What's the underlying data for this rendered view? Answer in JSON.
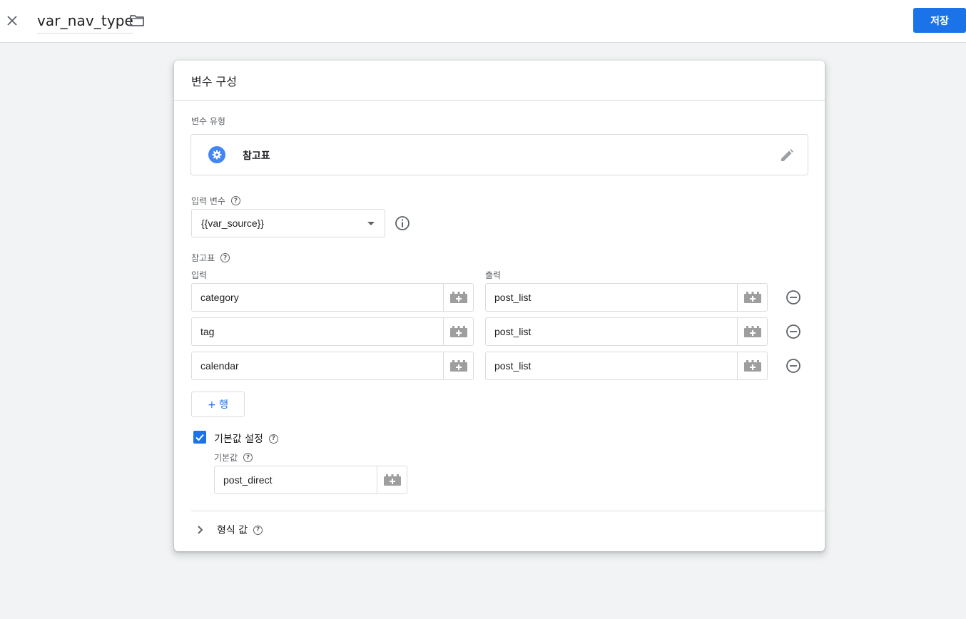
{
  "header": {
    "title": "var_nav_type",
    "save_label": "저장"
  },
  "card": {
    "title": "변수 구성",
    "variable_type": {
      "label": "변수 유형",
      "name": "참고표",
      "icon": "gear-icon"
    },
    "input_variable": {
      "label": "입력 변수",
      "selected": "{{var_source}}"
    },
    "lookup_table": {
      "label": "참고표",
      "input_header": "입력",
      "output_header": "출력",
      "rows": [
        {
          "input": "category",
          "output": "post_list"
        },
        {
          "input": "tag",
          "output": "post_list"
        },
        {
          "input": "calendar",
          "output": "post_list"
        }
      ],
      "add_row_label": "+ 행"
    },
    "default_value": {
      "checkbox_label": "기본값 설정",
      "checked": true,
      "field_label": "기본값",
      "value": "post_direct"
    },
    "format_value": {
      "label": "형식 값"
    }
  },
  "colors": {
    "accent": "#1a73e8",
    "icon_blue": "#4285f4",
    "border": "#dadce0",
    "background": "#f1f3f4"
  }
}
